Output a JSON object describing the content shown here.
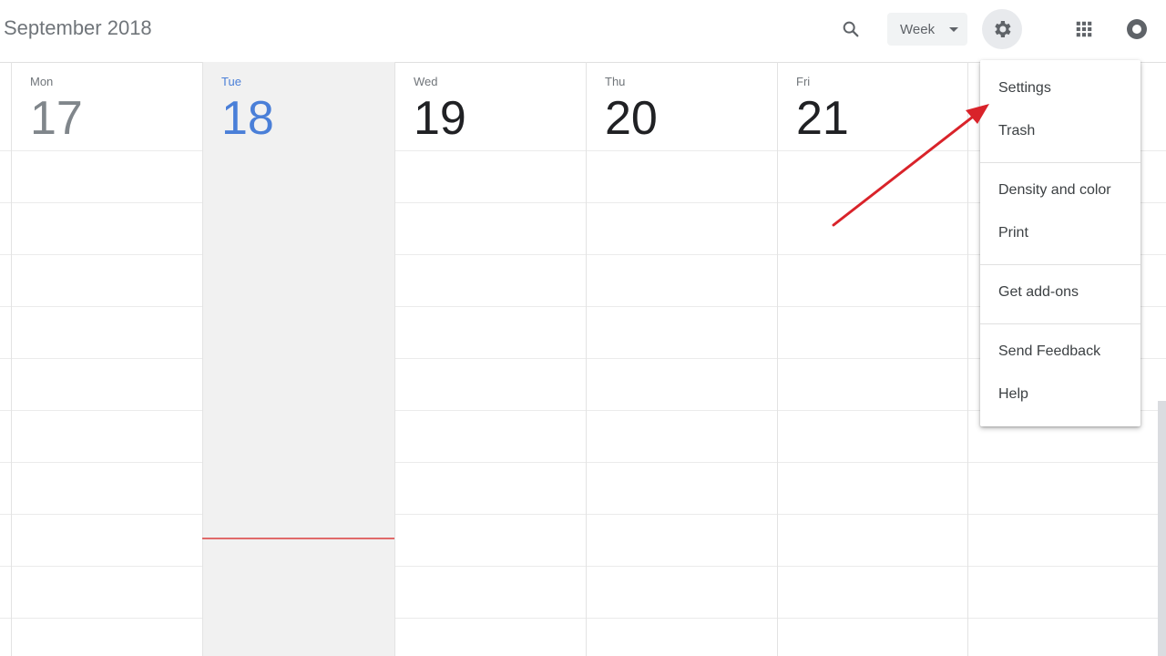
{
  "header": {
    "title": "September 2018",
    "view_selector": {
      "selected": "Week"
    },
    "icons": [
      "search-icon",
      "settings-gear-icon",
      "apps-grid-icon",
      "account-icon"
    ]
  },
  "week": {
    "days": [
      {
        "name": "Mon",
        "number": "17"
      },
      {
        "name": "Tue",
        "number": "18"
      },
      {
        "name": "Wed",
        "number": "19"
      },
      {
        "name": "Thu",
        "number": "20"
      },
      {
        "name": "Fri",
        "number": "21"
      }
    ],
    "today": "Tue"
  },
  "settings_menu": {
    "items": [
      {
        "label": "Settings"
      },
      {
        "label": "Trash"
      },
      {
        "label": "Density and color"
      },
      {
        "label": "Print"
      },
      {
        "label": "Get add-ons"
      },
      {
        "label": "Send Feedback"
      },
      {
        "label": "Help"
      }
    ]
  },
  "colors": {
    "today_accent": "#4a7fd8",
    "current_time_line": "#e06a6a",
    "annotation_arrow": "#d9232a"
  }
}
